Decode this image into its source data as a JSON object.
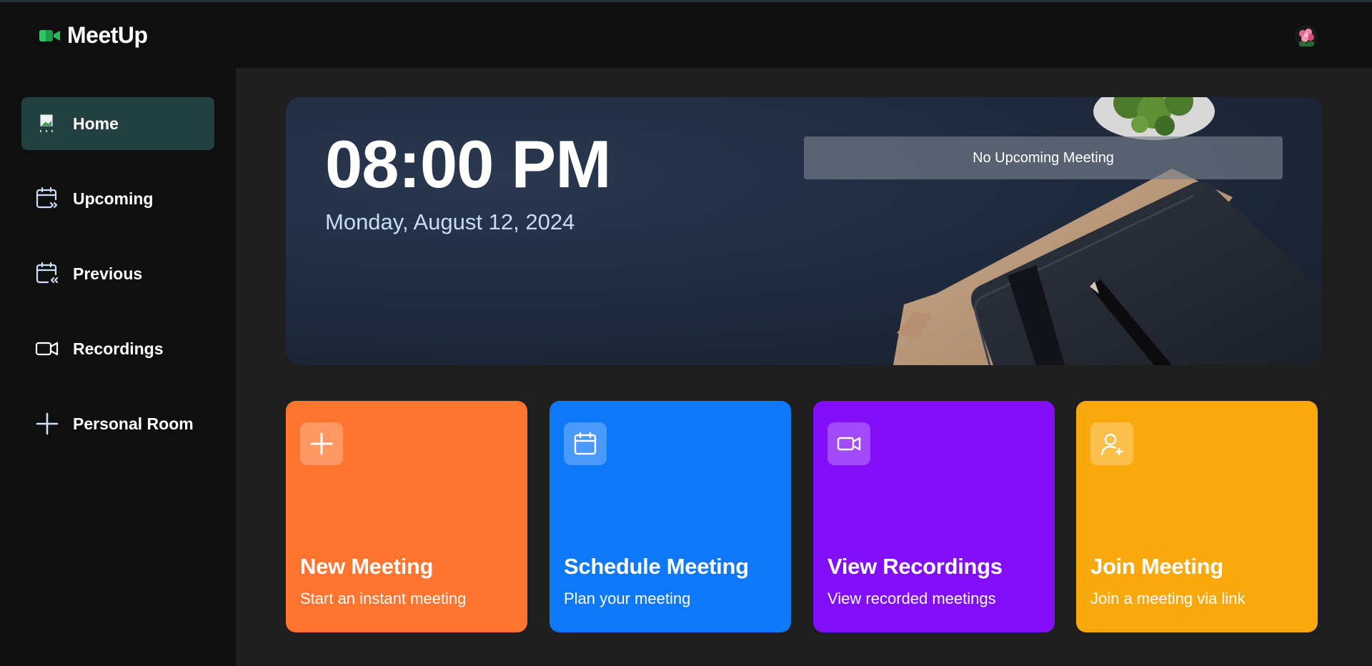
{
  "app": {
    "name": "MeetUp",
    "icon": "video-camera-icon",
    "brand_color": "#1fbf5a"
  },
  "header": {
    "avatar": "user-avatar"
  },
  "sidebar": {
    "items": [
      {
        "label": "Home",
        "icon": "home-image-icon",
        "active": true
      },
      {
        "label": "Upcoming",
        "icon": "calendar-forward-icon",
        "active": false
      },
      {
        "label": "Previous",
        "icon": "calendar-back-icon",
        "active": false
      },
      {
        "label": "Recordings",
        "icon": "video-icon",
        "active": false
      },
      {
        "label": "Personal Room",
        "icon": "plus-icon",
        "active": false
      }
    ],
    "active_color": "#234040"
  },
  "hero": {
    "time": "08:00 PM",
    "date": "Monday, August 12, 2024",
    "upcoming_text": "No Upcoming Meeting"
  },
  "cards": [
    {
      "title": "New Meeting",
      "subtitle": "Start an instant meeting",
      "icon": "plus-icon",
      "color": "#ff742e"
    },
    {
      "title": "Schedule Meeting",
      "subtitle": "Plan your meeting",
      "icon": "calendar-icon",
      "color": "#0e78f9"
    },
    {
      "title": "View Recordings",
      "subtitle": "View recorded meetings",
      "icon": "video-icon",
      "color": "#830ef9"
    },
    {
      "title": "Join Meeting",
      "subtitle": "Join a meeting via link",
      "icon": "user-plus-icon",
      "color": "#f9a90e"
    }
  ]
}
